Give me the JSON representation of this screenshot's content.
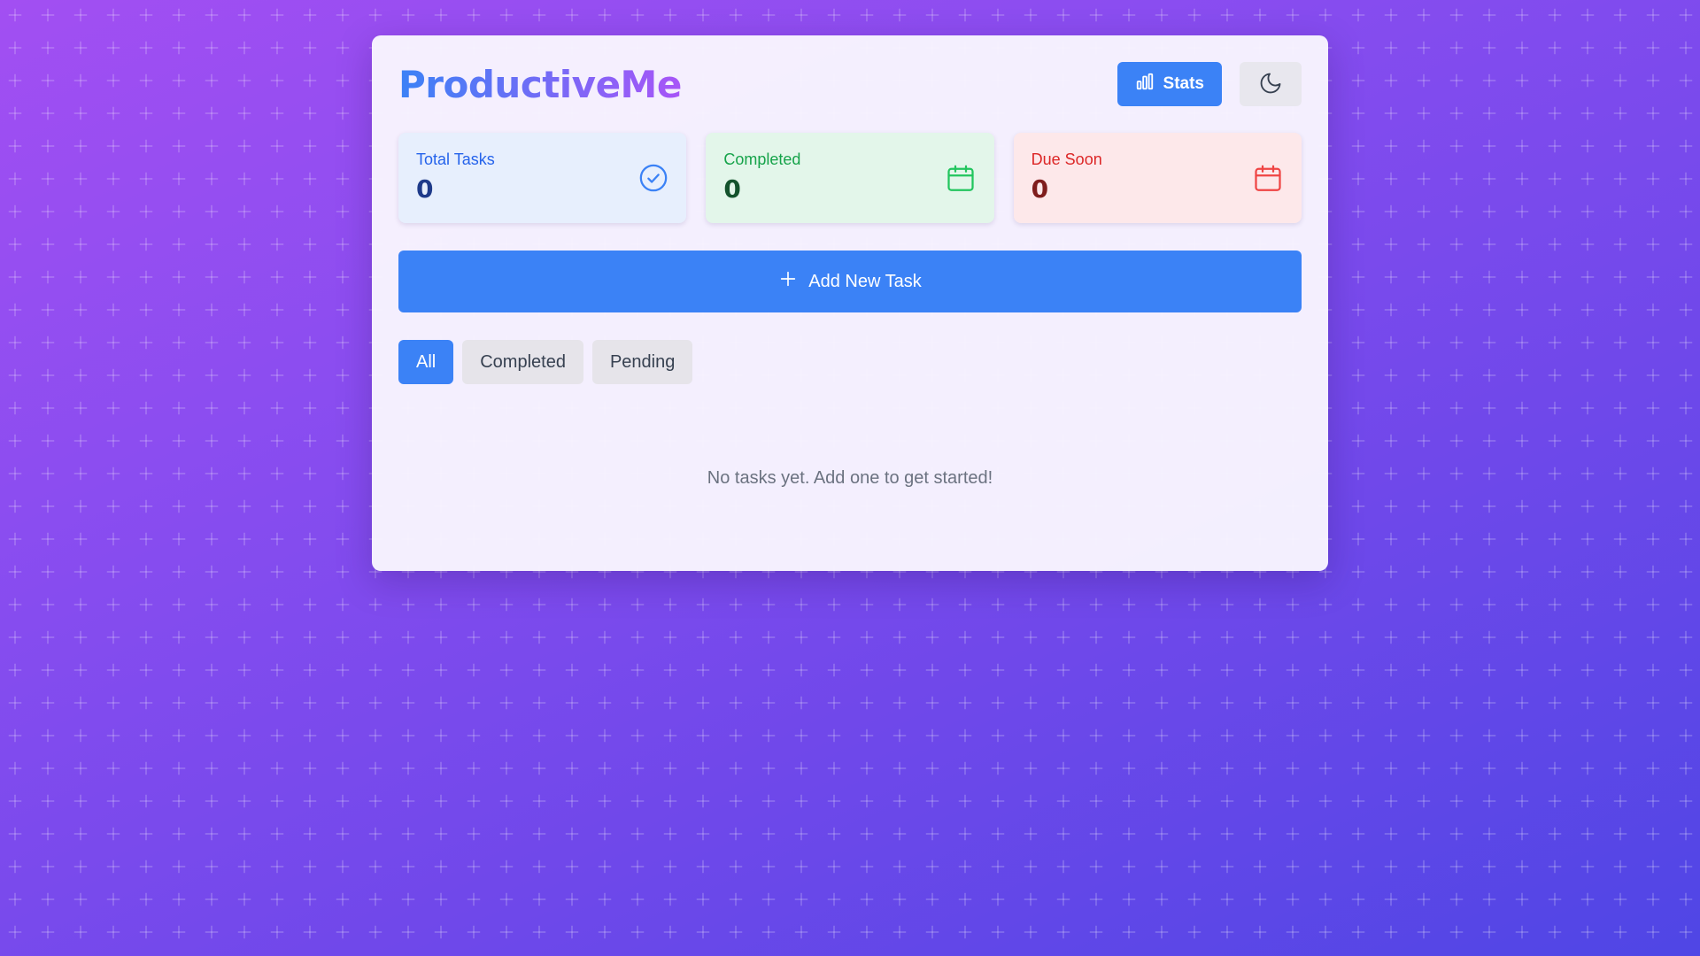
{
  "app": {
    "title": "ProductiveMe",
    "colors": {
      "accent": "#3b82f6",
      "brand_gradient_start": "#3b82f6",
      "brand_gradient_end": "#a855f7",
      "background_start": "#a24ff2",
      "background_end": "#4f46e5"
    }
  },
  "header": {
    "stats_label": "Stats",
    "stats_icon": "bar-chart-icon",
    "theme_icon": "moon-icon"
  },
  "stats": [
    {
      "label": "Total Tasks",
      "value": "0",
      "icon": "check-circle-icon",
      "color": "#2563eb"
    },
    {
      "label": "Completed",
      "value": "0",
      "icon": "calendar-icon",
      "color": "#16a34a"
    },
    {
      "label": "Due Soon",
      "value": "0",
      "icon": "calendar-icon",
      "color": "#dc2626"
    }
  ],
  "add_task": {
    "label": "Add New Task",
    "icon": "plus-icon"
  },
  "filters": [
    {
      "label": "All",
      "active": true
    },
    {
      "label": "Completed",
      "active": false
    },
    {
      "label": "Pending",
      "active": false
    }
  ],
  "empty_state": {
    "message": "No tasks yet. Add one to get started!"
  }
}
